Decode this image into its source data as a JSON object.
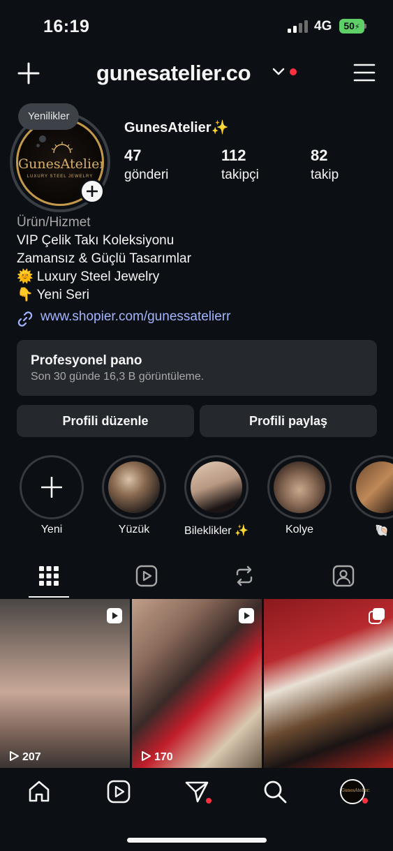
{
  "status_bar": {
    "time": "16:19",
    "network": "4G",
    "battery": "50"
  },
  "header": {
    "username": "gunesatelier.co"
  },
  "profile": {
    "note": "Yenilikler",
    "avatar_logo": "GunesAtelier.",
    "avatar_sub": "LUXURY STEEL JEWELRY",
    "display_name": "GunesAtelier✨",
    "stats": [
      {
        "value": "47",
        "label": "gönderi"
      },
      {
        "value": "112",
        "label": "takipçi"
      },
      {
        "value": "82",
        "label": "takip"
      }
    ],
    "category": "Ürün/Hizmet",
    "bio_lines": [
      "VIP Çelik Takı Koleksiyonu",
      "Zamansız & Güçlü Tasarımlar",
      "🌞 Luxury Steel Jewelry",
      "👇 Yeni Seri"
    ],
    "link": "www.shopier.com/gunessatelierr"
  },
  "dashboard": {
    "title": "Profesyonel pano",
    "subtitle": "Son 30 günde 16,3 B görüntüleme."
  },
  "actions": {
    "edit": "Profili düzenle",
    "share": "Profili paylaş"
  },
  "highlights": [
    {
      "label": "Yeni"
    },
    {
      "label": "Yüzük"
    },
    {
      "label": "Bileklikler ✨"
    },
    {
      "label": "Kolye"
    },
    {
      "label": "🐚"
    }
  ],
  "posts": [
    {
      "type": "reel",
      "views": "207"
    },
    {
      "type": "reel",
      "views": "170"
    },
    {
      "type": "carousel",
      "views": ""
    }
  ],
  "colors": {
    "background": "#0c1014",
    "link": "#a3b4ff",
    "notification": "#ff3040",
    "battery": "#5fd068"
  }
}
